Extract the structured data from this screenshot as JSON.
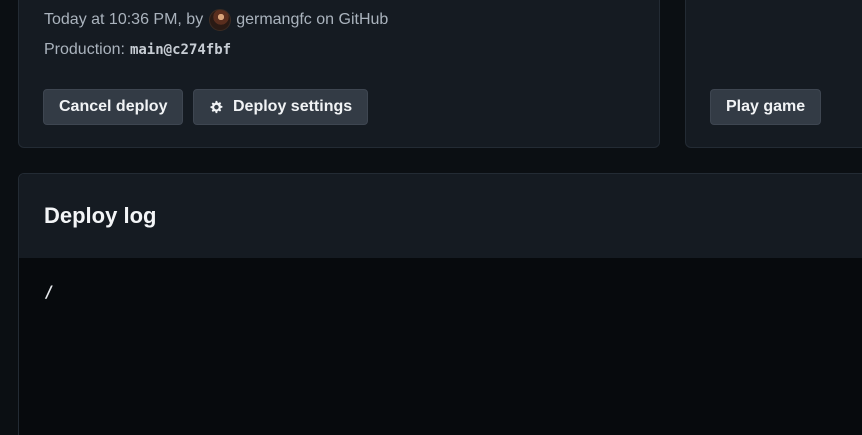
{
  "deploy_info": {
    "time_prefix": "Today at 10:36 PM, by",
    "author": "germangfc",
    "author_suffix": "on GitHub",
    "production_label": "Production:",
    "production_ref": "main@c274fbf"
  },
  "actions": {
    "cancel_label": "Cancel deploy",
    "settings_label": "Deploy settings",
    "play_label": "Play game"
  },
  "icons": {
    "settings": "gear-icon",
    "author": "avatar"
  },
  "log": {
    "title": "Deploy log",
    "content": "/"
  }
}
